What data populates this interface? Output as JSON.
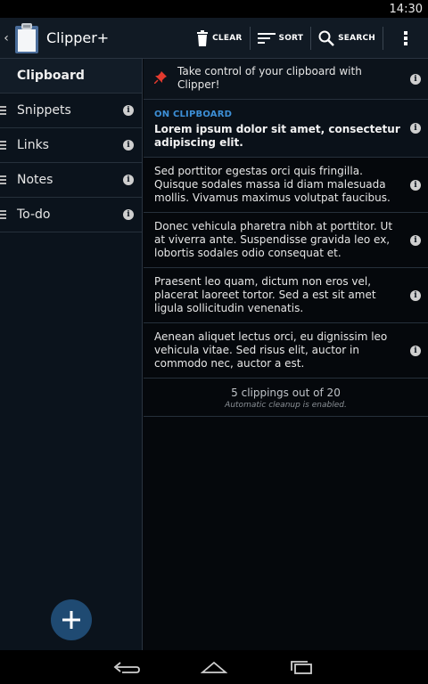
{
  "status_bar": {
    "time": "14:30"
  },
  "action_bar": {
    "title": "Clipper+",
    "clear_label": "CLEAR",
    "sort_label": "SORT",
    "search_label": "SEARCH"
  },
  "sidebar": {
    "header": "Clipboard",
    "items": [
      {
        "label": "Snippets"
      },
      {
        "label": "Links"
      },
      {
        "label": "Notes"
      },
      {
        "label": "To-do"
      }
    ]
  },
  "main": {
    "pinned": {
      "text": "Take control of your clipboard with Clipper!"
    },
    "current": {
      "label": "ON CLIPBOARD",
      "text": "Lorem ipsum dolor sit amet, consectetur adipiscing elit."
    },
    "clips": [
      {
        "text": "Sed porttitor egestas orci quis fringilla. Quisque sodales massa id diam malesuada mollis. Vivamus maximus volutpat faucibus."
      },
      {
        "text": "Donec vehicula pharetra nibh at porttitor. Ut at viverra ante. Suspendisse gravida leo ex, lobortis sodales odio consequat et."
      },
      {
        "text": "Praesent leo quam, dictum non eros vel, placerat laoreet tortor. Sed a est sit amet ligula sollicitudin venenatis."
      },
      {
        "text": "Aenean aliquet lectus orci, eu dignissim leo vehicula vitae. Sed risus elit, auctor in commodo nec, auctor a est."
      }
    ],
    "summary": {
      "count": "5 clippings out of 20",
      "cleanup": "Automatic cleanup is enabled."
    }
  },
  "colors": {
    "accent": "#3d8fd6",
    "fab": "#1f4a72",
    "pin": "#e23a2e",
    "background": "#05080c"
  }
}
